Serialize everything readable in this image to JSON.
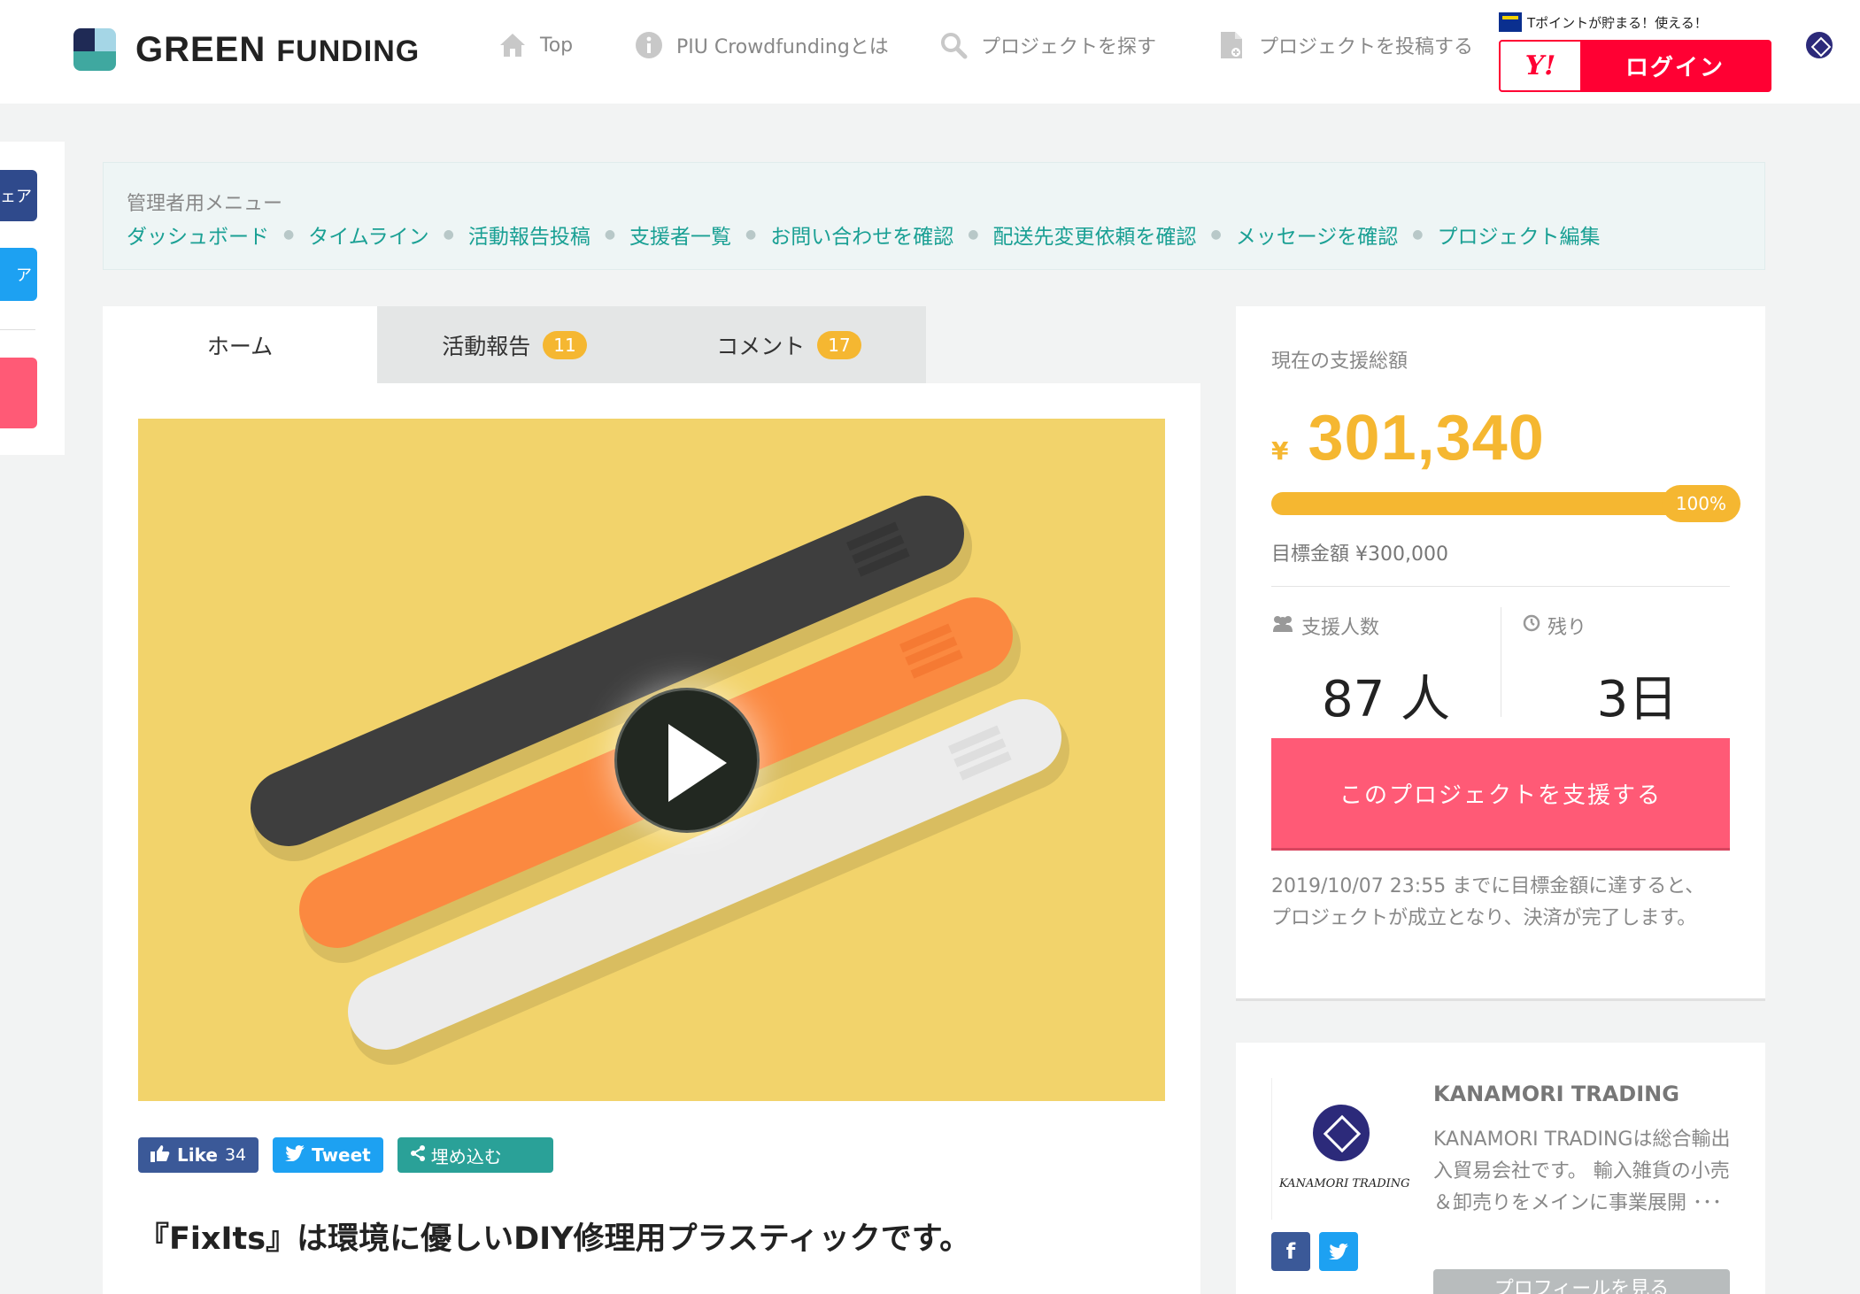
{
  "header": {
    "logo_main": "GREEN",
    "logo_sub": "FUNDING",
    "nav": [
      {
        "label": "Top",
        "icon": "home-icon"
      },
      {
        "label": "PIU Crowdfundingとは",
        "icon": "info-icon"
      },
      {
        "label": "プロジェクトを探す",
        "icon": "search-icon"
      },
      {
        "label": "プロジェクトを投稿する",
        "icon": "document-icon"
      }
    ],
    "tpoint_text": "Tポイントが貯まる！使える！",
    "yahoo_label": "Y!",
    "login_label": "ログイン"
  },
  "side_share": {
    "btn1": "ェア",
    "btn2": "ア"
  },
  "admin_menu": {
    "title": "管理者用メニュー",
    "links": [
      "ダッシュボード",
      "タイムライン",
      "活動報告投稿",
      "支援者一覧",
      "お問い合わせを確認",
      "配送先変更依頼を確認",
      "メッセージを確認",
      "プロジェクト編集"
    ]
  },
  "tabs": [
    {
      "label": "ホーム",
      "badge": ""
    },
    {
      "label": "活動報告",
      "badge": "11"
    },
    {
      "label": "コメント",
      "badge": "17"
    }
  ],
  "social": {
    "like_label": "Like",
    "like_count": "34",
    "tweet_label": "Tweet",
    "embed_label": "埋め込む"
  },
  "project_title": "『FixIts』は環境に優しいDIY修理用プラスティックです。",
  "funding": {
    "label": "現在の支援総額",
    "currency": "¥",
    "amount": "301,340",
    "percent": "100%",
    "percent_value": 1.0,
    "goal": "目標金額 ¥300,000",
    "backers_label": "支援人数",
    "backers_value": "87 人",
    "remaining_label": "残り",
    "remaining_value": "3日",
    "support_button": "このプロジェクトを支援する",
    "note": "2019/10/07 23:55 までに目標金額に達すると、プロジェクトが成立となり、決済が完了します。"
  },
  "owner": {
    "name": "KANAMORI TRADING",
    "logo_caption": "KANAMORI TRADING",
    "description": "KANAMORI TRADINGは総合輸出入貿易会社です。 輸入雑貨の小売＆卸売りをメインに事業展開 ･･･",
    "profile_button": "プロフィールを見る"
  },
  "colors": {
    "brand_teal": "#1aa094",
    "accent_yellow": "#f5b731",
    "support_pink": "#ff5a76",
    "yahoo_red": "#ff0033",
    "facebook": "#3b5998",
    "twitter": "#1da1f2",
    "embed": "#2aa198"
  }
}
